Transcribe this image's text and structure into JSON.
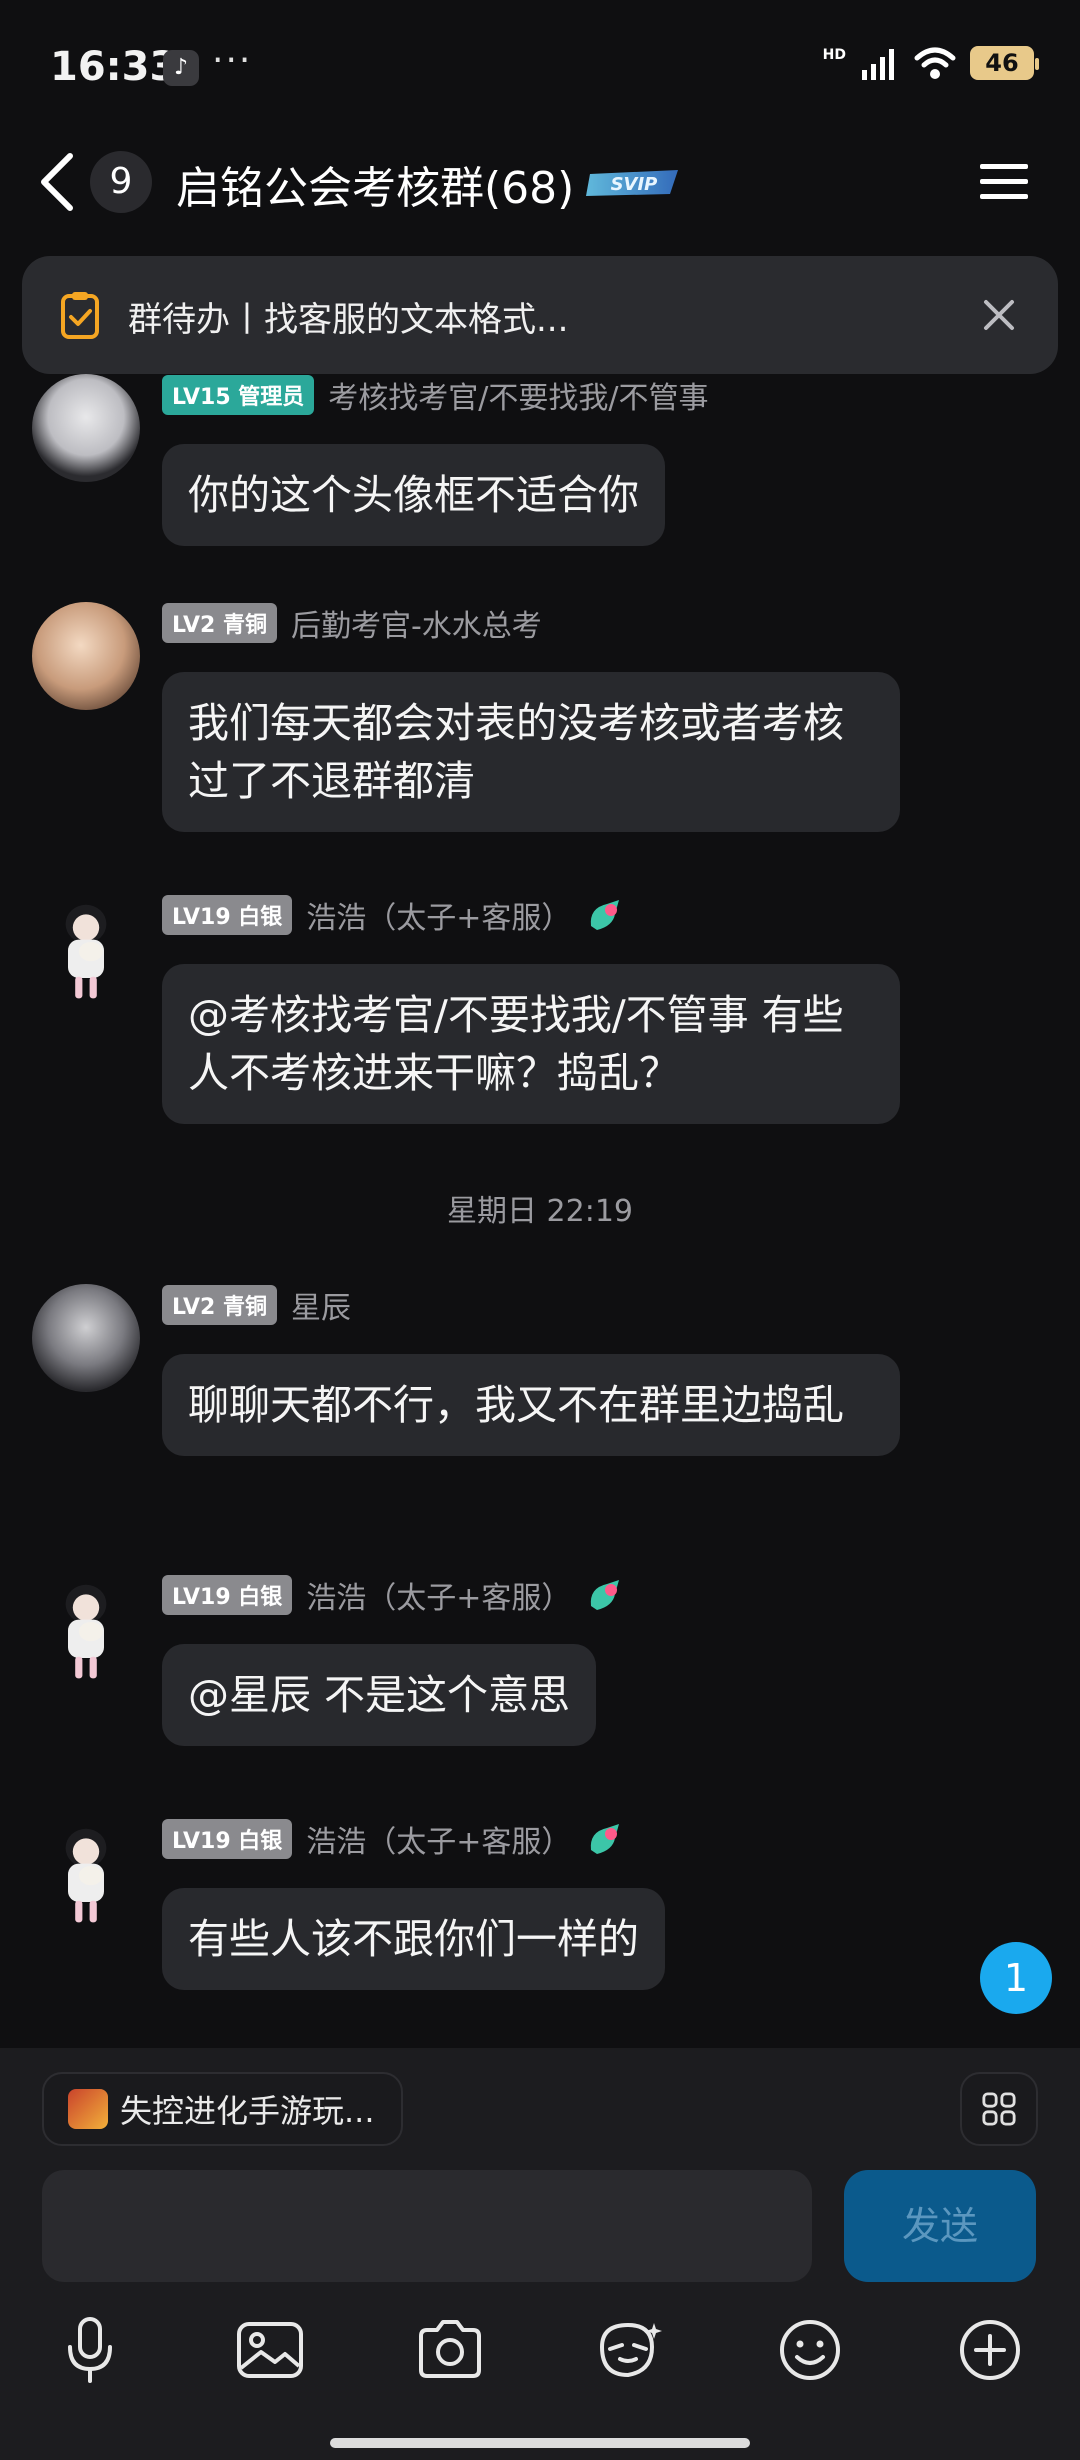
{
  "status_bar": {
    "time": "16:33",
    "app_icon": "tiktok-icon",
    "more": "···",
    "network": "HD",
    "battery": "46"
  },
  "header": {
    "unread_count": "9",
    "title": "启铭公会考核群(68)",
    "title_badge": "SVIP",
    "icons": [
      "back-chevron-icon",
      "menu-icon"
    ]
  },
  "todo_banner": {
    "text": "群待办丨找客服的文本格式...",
    "icons": [
      "todo-clipboard-icon",
      "close-icon"
    ]
  },
  "messages": [
    {
      "level": "LV15 管理员",
      "sender": "考核找考官/不要找我/不管事",
      "text": "你的这个头像框不适合你",
      "badge_color": "#2ba89a"
    },
    {
      "level": "LV2 青铜",
      "sender": "后勤考官-水水总考",
      "text": "我们每天都会对表的没考核或者考核过了不退群都清"
    },
    {
      "level": "LV19 白银",
      "sender": "浩浩（太子+客服）",
      "text": "@考核找考官/不要找我/不管事 有些人不考核进来干嘛？捣乱？"
    },
    {
      "level": "LV2 青铜",
      "sender": "星辰",
      "text": "聊聊天都不行，我又不在群里边捣乱"
    },
    {
      "level": "LV19 白银",
      "sender": "浩浩（太子+客服）",
      "text": "@星辰 不是这个意思"
    },
    {
      "level": "LV19 白银",
      "sender": "浩浩（太子+客服）",
      "text": "有些人该不跟你们一样的"
    }
  ],
  "time_separator": "星期日 22:19",
  "new_message_count": "1",
  "bottom": {
    "game_chip": "失控进化手游玩...",
    "input_value": "",
    "input_placeholder": "",
    "send_label": "发送",
    "toolbar_icons": [
      "microphone-icon",
      "image-icon",
      "camera-icon",
      "sticker-icon",
      "emoji-icon",
      "plus-icon"
    ]
  },
  "colors": {
    "background": "#0f0f11",
    "bubble": "#28292d",
    "accent": "#1aa9ee",
    "send": "#0b5a8c"
  }
}
